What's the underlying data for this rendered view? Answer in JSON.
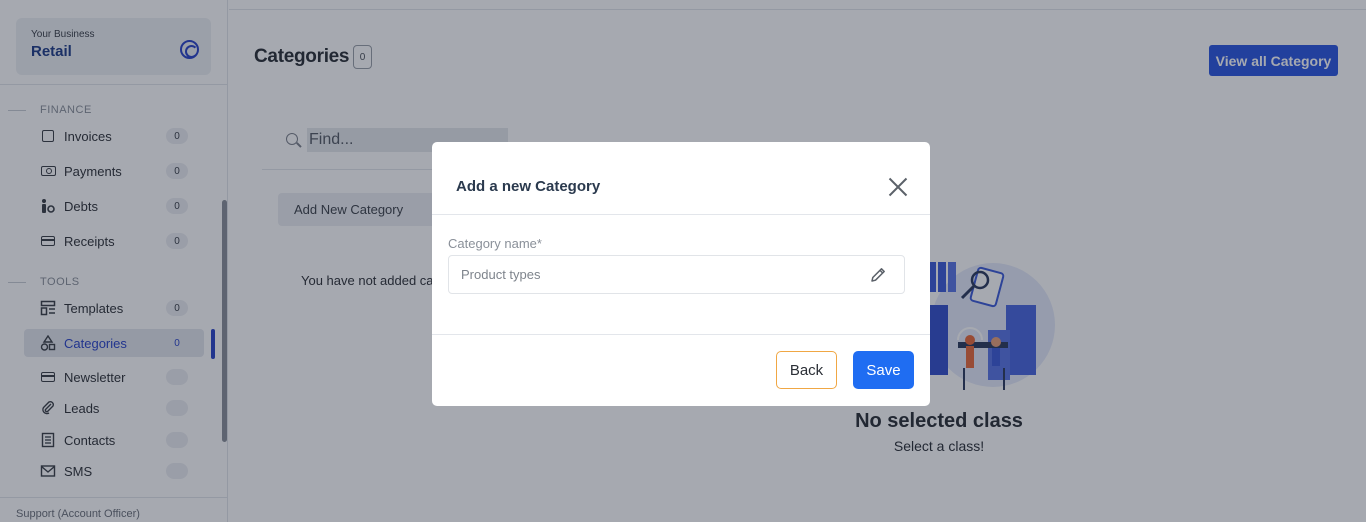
{
  "sidebar": {
    "business": {
      "kicker": "Your Business",
      "name": "Retail"
    },
    "finance_label": "FINANCE",
    "tools_label": "TOOLS",
    "finance_items": [
      {
        "label": "Invoices",
        "count": "0",
        "icon": "invoice-icon"
      },
      {
        "label": "Payments",
        "count": "0",
        "icon": "cash-icon"
      },
      {
        "label": "Debts",
        "count": "0",
        "icon": "debts-icon"
      },
      {
        "label": "Receipts",
        "count": "0",
        "icon": "card-icon"
      }
    ],
    "tools_items": [
      {
        "label": "Templates",
        "count": "0",
        "icon": "template-icon"
      },
      {
        "label": "Categories",
        "count": "0",
        "icon": "shapes-icon",
        "active": true
      },
      {
        "label": "Newsletter",
        "count": "",
        "icon": "card-icon"
      },
      {
        "label": "Leads",
        "count": "",
        "icon": "paperclip-icon"
      },
      {
        "label": "Contacts",
        "count": "",
        "icon": "contacts-icon"
      },
      {
        "label": "SMS",
        "count": "",
        "icon": "mail-icon"
      }
    ],
    "support": "Support (Account Officer)"
  },
  "main": {
    "title": "Categories",
    "title_count": "0",
    "view_all_label": "View all Category",
    "search_placeholder": "Find...",
    "add_category_label": "Add New Category",
    "empty_left_text": "You have not added category",
    "no_selection_title": "No selected class",
    "no_selection_subtitle": "Select a class!"
  },
  "modal": {
    "title": "Add a new Category",
    "field_label": "Category name*",
    "field_placeholder": "Product types",
    "back_label": "Back",
    "save_label": "Save"
  },
  "colors": {
    "accent": "#2a56e0",
    "save_button": "#1f6df2",
    "back_border": "#f0a744",
    "overlay": "rgba(20, 28, 48, 0.38)"
  }
}
